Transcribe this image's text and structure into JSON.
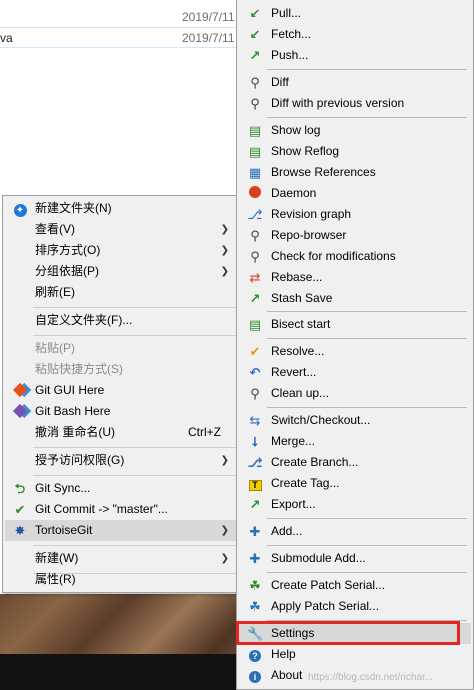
{
  "explorer": {
    "rows": [
      {
        "name": "",
        "date": "2019/7/11"
      },
      {
        "name": "va",
        "date": "2019/7/11"
      }
    ]
  },
  "main_menu": {
    "items": [
      {
        "label": "新建文件夹(N)",
        "icon": "new-folder-icon"
      },
      {
        "label": "查看(V)"
      },
      {
        "label": "排序方式(O)"
      },
      {
        "label": "分组依据(P)"
      },
      {
        "label": "刷新(E)"
      },
      {
        "label": "自定义文件夹(F)..."
      },
      {
        "label": "粘贴(P)"
      },
      {
        "label": "粘贴快捷方式(S)"
      },
      {
        "label": "Git GUI Here",
        "icon": "git-gui-icon"
      },
      {
        "label": "Git Bash Here",
        "icon": "git-bash-icon"
      },
      {
        "label": "撤消 重命名(U)",
        "shortcut": "Ctrl+Z"
      },
      {
        "label": "授予访问权限(G)"
      },
      {
        "label": "Git Sync...",
        "icon": "git-sync-icon"
      },
      {
        "label": "Git Commit -> \"master\"...",
        "icon": "git-commit-icon"
      },
      {
        "label": "TortoiseGit",
        "icon": "tortoisegit-icon"
      },
      {
        "label": "新建(W)"
      },
      {
        "label": "属性(R)"
      }
    ]
  },
  "git_menu": {
    "items": [
      {
        "label": "Pull..."
      },
      {
        "label": "Fetch..."
      },
      {
        "label": "Push..."
      },
      {
        "label": "Diff"
      },
      {
        "label": "Diff with previous version"
      },
      {
        "label": "Show log"
      },
      {
        "label": "Show Reflog"
      },
      {
        "label": "Browse References"
      },
      {
        "label": "Daemon"
      },
      {
        "label": "Revision graph"
      },
      {
        "label": "Repo-browser"
      },
      {
        "label": "Check for modifications"
      },
      {
        "label": "Rebase..."
      },
      {
        "label": "Stash Save"
      },
      {
        "label": "Bisect start"
      },
      {
        "label": "Resolve..."
      },
      {
        "label": "Revert..."
      },
      {
        "label": "Clean up..."
      },
      {
        "label": "Switch/Checkout..."
      },
      {
        "label": "Merge..."
      },
      {
        "label": "Create Branch..."
      },
      {
        "label": "Create Tag..."
      },
      {
        "label": "Export..."
      },
      {
        "label": "Add..."
      },
      {
        "label": "Submodule Add..."
      },
      {
        "label": "Create Patch Serial..."
      },
      {
        "label": "Apply Patch Serial..."
      },
      {
        "label": "Settings"
      },
      {
        "label": "Help"
      },
      {
        "label": "About"
      }
    ]
  },
  "watermark": "https://blog.csdn.net/richar...",
  "colors": {
    "menu_bg": "#f0f0f0",
    "hover_bg": "#d8d8d8",
    "highlight_border": "#e32626",
    "disabled_text": "#8d8d8d",
    "git_green": "#2e8b2e",
    "git_orange": "#e8501f"
  }
}
